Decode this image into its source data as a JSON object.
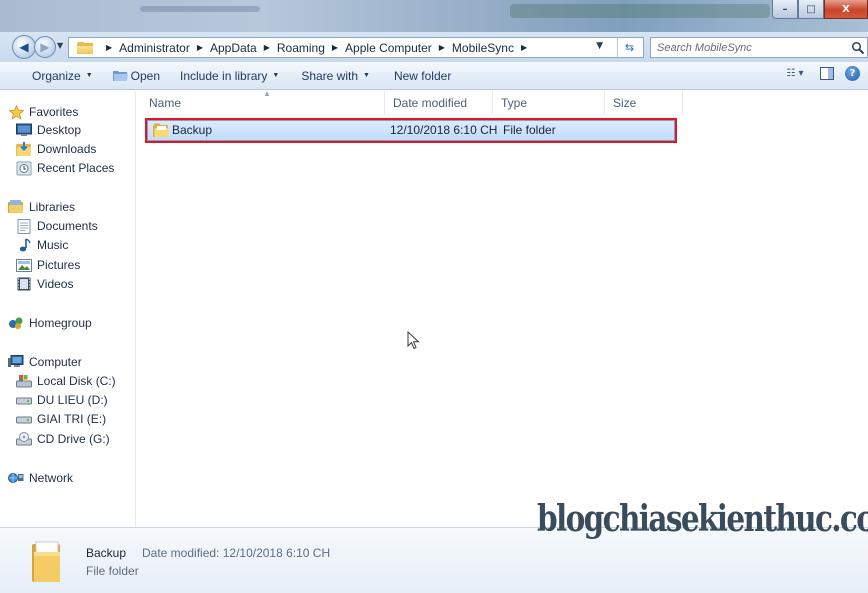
{
  "window": {
    "controls": {
      "minimize": "–",
      "maximize": "□",
      "close": "X"
    }
  },
  "address": {
    "crumbs": [
      "Administrator",
      "AppData",
      "Roaming",
      "Apple Computer",
      "MobileSync"
    ],
    "search_placeholder": "Search MobileSync"
  },
  "toolbar": {
    "organize": "Organize",
    "open": "Open",
    "include_in_library": "Include in library",
    "share_with": "Share with",
    "new_folder": "New folder"
  },
  "sidebar": {
    "favorites": {
      "label": "Favorites",
      "items": [
        "Desktop",
        "Downloads",
        "Recent Places"
      ]
    },
    "libraries": {
      "label": "Libraries",
      "items": [
        "Documents",
        "Music",
        "Pictures",
        "Videos"
      ]
    },
    "homegroup": {
      "label": "Homegroup"
    },
    "computer": {
      "label": "Computer",
      "items": [
        "Local Disk (C:)",
        "DU LIEU (D:)",
        "GIAI TRI (E:)",
        "CD Drive (G:)"
      ]
    },
    "network": {
      "label": "Network"
    }
  },
  "columns": {
    "name": "Name",
    "date_modified": "Date modified",
    "type": "Type",
    "size": "Size"
  },
  "files": [
    {
      "name": "Backup",
      "date_modified": "12/10/2018 6:10 CH",
      "type": "File folder",
      "size": ""
    }
  ],
  "details": {
    "name": "Backup",
    "type": "File folder",
    "date_label": "Date modified:",
    "date_value": "12/10/2018 6:10 CH"
  },
  "watermark": "blogchiasekienthuc.com",
  "colors": {
    "selection_outline": "#e3151c",
    "selection_fill": "#c1dcfa",
    "folder": "#f2c555"
  }
}
